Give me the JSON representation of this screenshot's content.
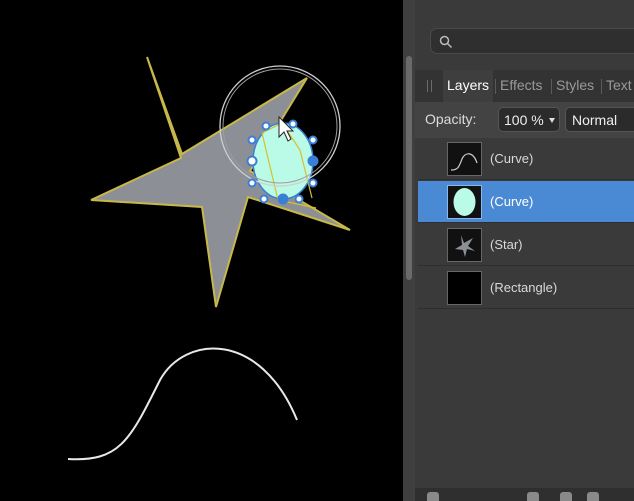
{
  "panel": {
    "search": {
      "placeholder": ""
    },
    "tabs": [
      {
        "label": "Layers",
        "active": true
      },
      {
        "label": "Effects",
        "active": false
      },
      {
        "label": "Styles",
        "active": false
      },
      {
        "label": "Text",
        "active": false
      }
    ],
    "options": {
      "opacity_label": "Opacity:",
      "opacity_value": "100 %",
      "blend_mode": "Normal"
    },
    "layers": [
      {
        "name": "(Curve)",
        "selected": false,
        "thumb": "curve"
      },
      {
        "name": "(Curve)",
        "selected": true,
        "thumb": "ellipse"
      },
      {
        "name": "(Star)",
        "selected": false,
        "thumb": "star"
      },
      {
        "name": "(Rectangle)",
        "selected": false,
        "thumb": "rectangle"
      }
    ]
  },
  "colors": {
    "selection_blue": "#4a8ad4",
    "star_fill": "#8c8f96",
    "star_stroke": "#c8b84a",
    "ellipse_fill": "#b9fbe6",
    "handle_blue": "#3a7fd6"
  }
}
